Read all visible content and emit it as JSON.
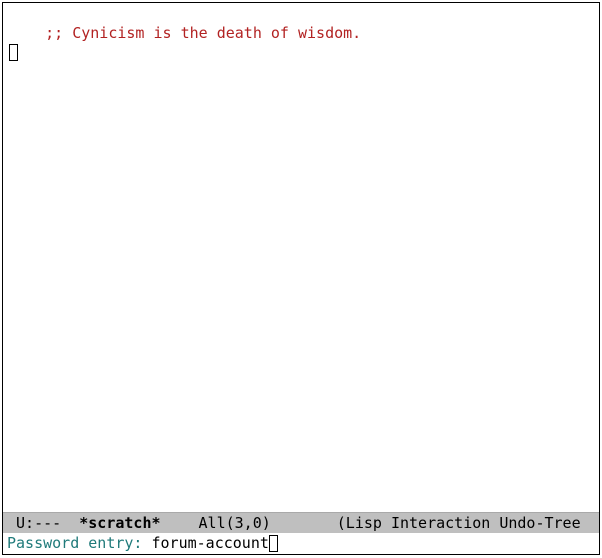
{
  "buffer": {
    "comment_line": ";; Cynicism is the death of wisdom."
  },
  "mode_line": {
    "left": " U:---  ",
    "buffer_name": "*scratch*",
    "position": "All",
    "coords": "(3,0)",
    "modes": "(Lisp Interaction Undo-Tree"
  },
  "minibuffer": {
    "prompt": "Password entry: ",
    "input": "forum-account"
  }
}
